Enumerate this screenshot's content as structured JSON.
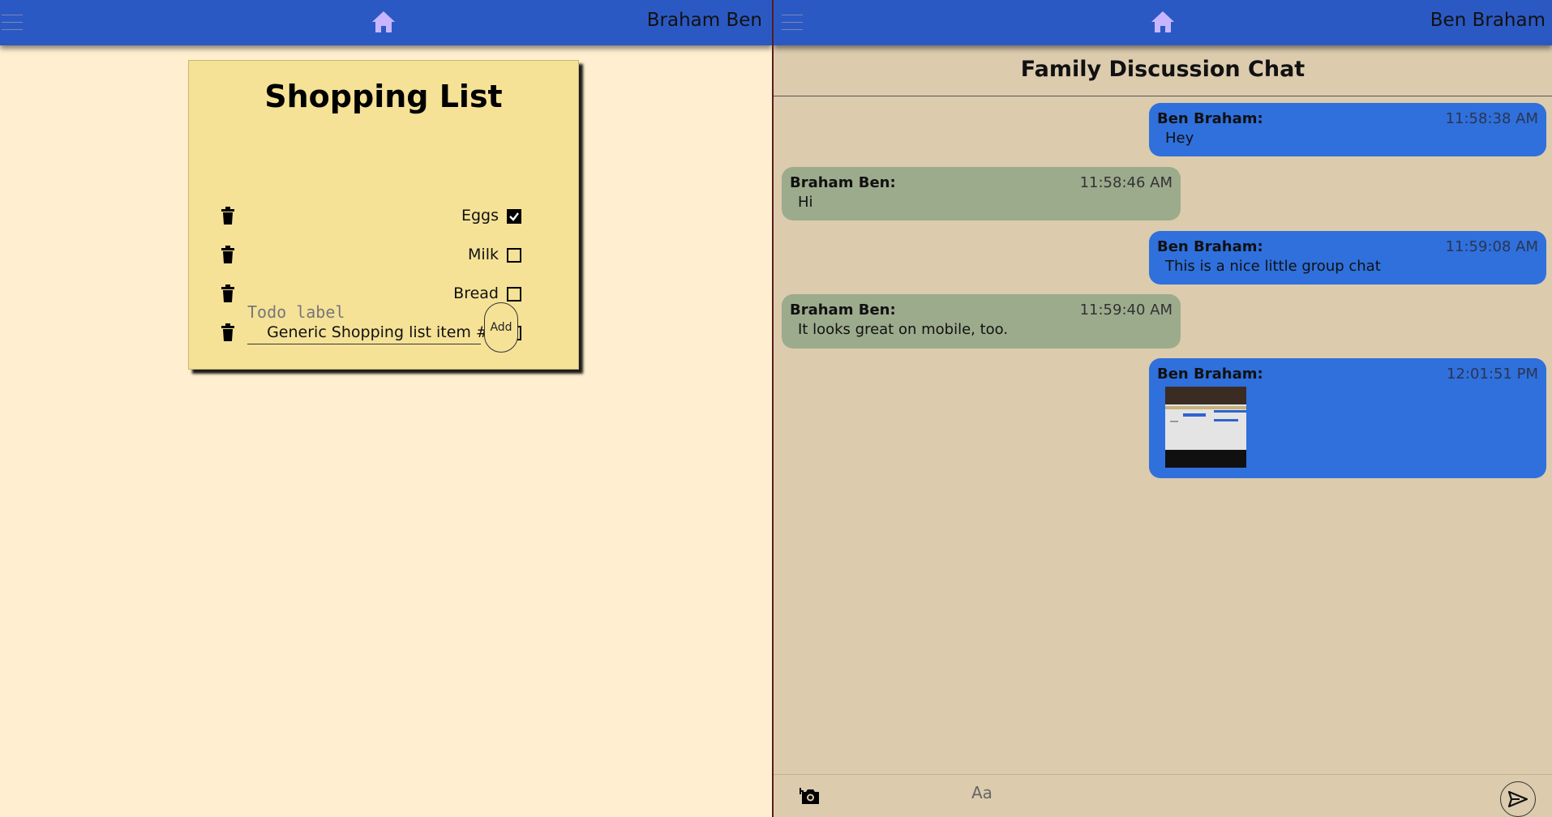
{
  "left": {
    "header": {
      "username": "Braham Ben"
    },
    "shopping_list": {
      "title": "Shopping List",
      "items": [
        {
          "label": "Eggs",
          "checked": true
        },
        {
          "label": "Milk",
          "checked": false
        },
        {
          "label": "Bread",
          "checked": false
        },
        {
          "label": "Generic Shopping list item #4",
          "checked": false
        }
      ],
      "input_placeholder": "Todo label",
      "add_label": "Add"
    }
  },
  "right": {
    "header": {
      "username": "Ben Braham"
    },
    "chat": {
      "title": "Family Discussion Chat",
      "messages": [
        {
          "sender": "Ben Braham:",
          "time": "11:58:38 AM",
          "text": "Hey",
          "own": true
        },
        {
          "sender": "Braham Ben:",
          "time": "11:58:46 AM",
          "text": "Hi",
          "own": false
        },
        {
          "sender": "Ben Braham:",
          "time": "11:59:08 AM",
          "text": "This is a nice little group chat",
          "own": true
        },
        {
          "sender": "Braham Ben:",
          "time": "11:59:40 AM",
          "text": "It looks great on mobile, too.",
          "own": false
        },
        {
          "sender": "Ben Braham:",
          "time": "12:01:51 PM",
          "text": "",
          "own": true,
          "has_image": true
        }
      ],
      "input_placeholder": "Aa"
    }
  },
  "colors": {
    "topbar": "#2b59c3",
    "home_icon": "#c7b6ff",
    "own_bubble": "#2f70dc",
    "other_bubble": "#9dab8d",
    "card": "#f5e297",
    "left_bg": "#ffeecf",
    "chat_bg": "#dccbad"
  },
  "icons": [
    "hamburger-icon",
    "home-icon",
    "trash-icon",
    "checkbox-icon",
    "camera-icon",
    "send-icon"
  ]
}
